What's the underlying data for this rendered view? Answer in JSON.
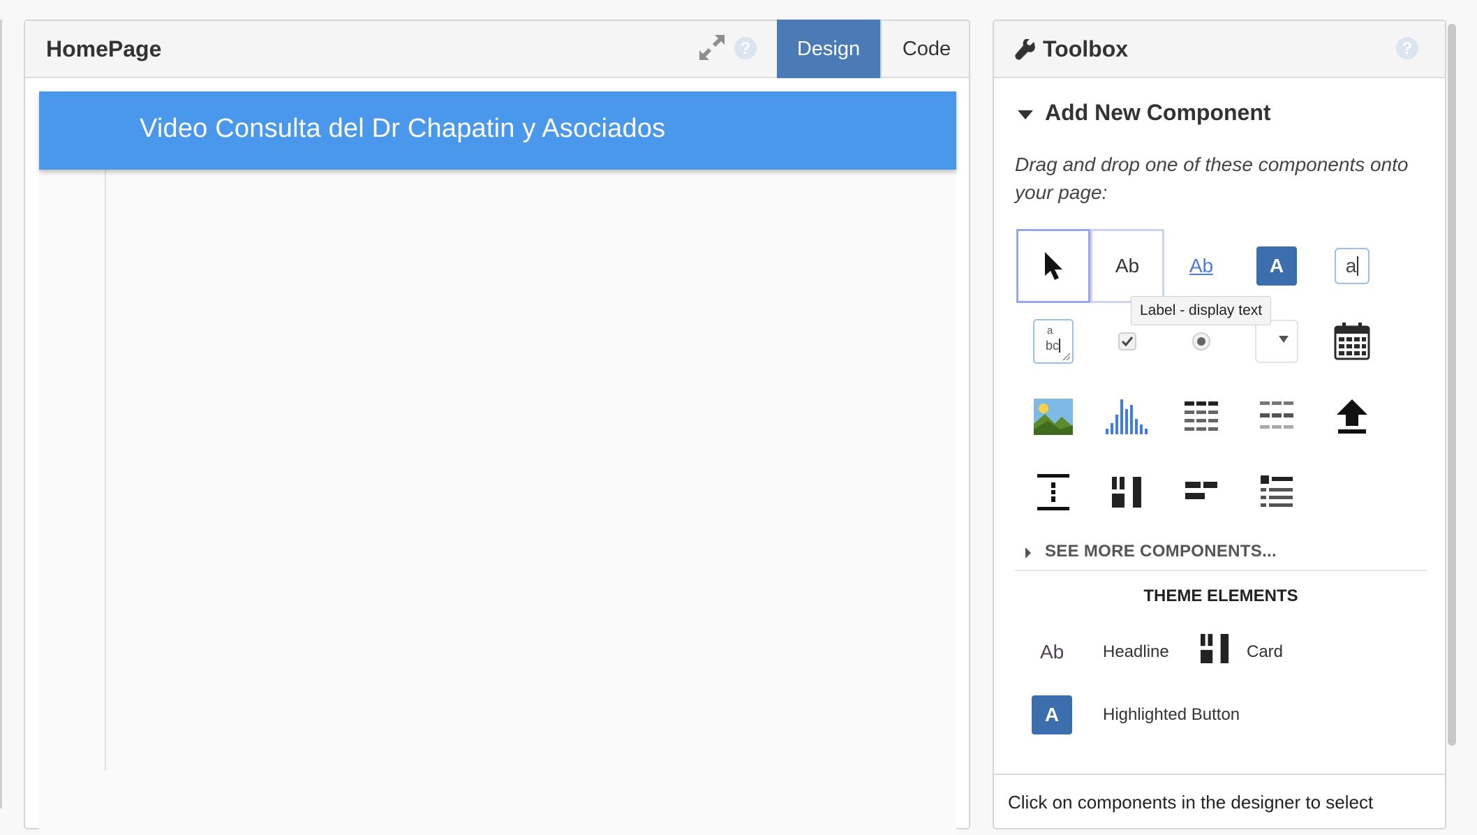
{
  "designer": {
    "title": "HomePage",
    "tabs": {
      "design": "Design",
      "code": "Code"
    },
    "app_bar_title": "Video Consulta del Dr Chapatin y Asociados",
    "app_bar_color": "#4a98eb",
    "active_tab_color": "#4a7bb6"
  },
  "toolbox": {
    "title": "Toolbox",
    "section_title": "Add New Component",
    "description": "Drag and drop one of these components onto your page:",
    "components": [
      {
        "name": "pointer",
        "icon": "cursor-icon"
      },
      {
        "name": "label",
        "icon": "label-ab-icon",
        "text": "Ab"
      },
      {
        "name": "link",
        "icon": "link-ab-icon",
        "text": "Ab"
      },
      {
        "name": "button",
        "icon": "button-a-icon",
        "text": "A"
      },
      {
        "name": "textbox",
        "icon": "textbox-icon",
        "text": "a"
      },
      {
        "name": "textarea",
        "icon": "textarea-icon",
        "text_top": "a",
        "text_bottom": "bc"
      },
      {
        "name": "checkbox",
        "icon": "checkbox-icon"
      },
      {
        "name": "radio-button",
        "icon": "radio-icon"
      },
      {
        "name": "dropdown",
        "icon": "dropdown-icon"
      },
      {
        "name": "date-picker",
        "icon": "calendar-icon"
      },
      {
        "name": "image",
        "icon": "image-icon"
      },
      {
        "name": "plot",
        "icon": "bar-chart-icon"
      },
      {
        "name": "data-grid",
        "icon": "data-grid-icon"
      },
      {
        "name": "repeating-panel",
        "icon": "repeating-panel-icon"
      },
      {
        "name": "file-loader",
        "icon": "upload-icon"
      },
      {
        "name": "spacer",
        "icon": "spacer-icon"
      },
      {
        "name": "column-panel",
        "icon": "column-panel-icon"
      },
      {
        "name": "flow-panel",
        "icon": "flow-panel-icon"
      },
      {
        "name": "linear-panel",
        "icon": "linear-panel-icon"
      }
    ],
    "tooltip": "Label - display text",
    "see_more": "SEE MORE COMPONENTS...",
    "theme_title": "THEME ELEMENTS",
    "theme_items": [
      {
        "label": "Headline",
        "icon_text": "Ab"
      },
      {
        "label": "Card"
      },
      {
        "label": "Highlighted Button",
        "icon_text": "A"
      }
    ],
    "bottom_text": "Click on components in the designer to select"
  }
}
